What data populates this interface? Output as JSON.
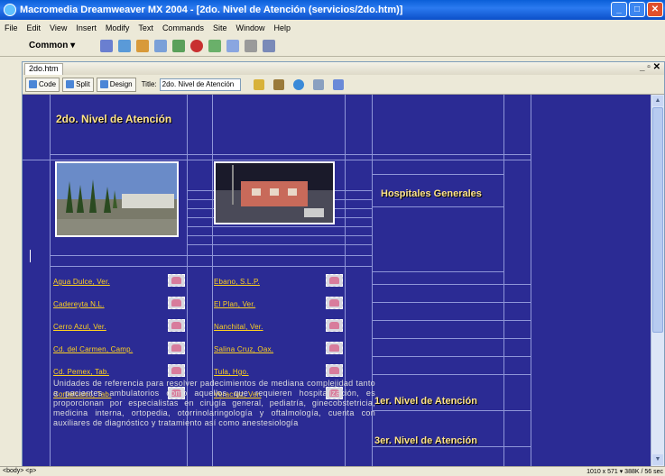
{
  "window": {
    "title": "Macromedia Dreamweaver MX 2004 - [2do. Nivel de Atención (servicios/2do.htm)]"
  },
  "menu": [
    "File",
    "Edit",
    "View",
    "Insert",
    "Modify",
    "Text",
    "Commands",
    "Site",
    "Window",
    "Help"
  ],
  "insert_bar": {
    "category": "Common ▾"
  },
  "document": {
    "tab": "2do.htm",
    "view_buttons": {
      "code": "Code",
      "split": "Split",
      "design": "Design"
    },
    "title_label": "Title:",
    "title_value": "2do. Nivel de Atención"
  },
  "page": {
    "heading": "2do. Nivel de Atención",
    "side_heading": "Hospitales Generales",
    "links_left": [
      "Agua Dulce, Ver.",
      "Cadereyta N.L.",
      "Cerro Azul, Ver.",
      "Cd. del Carmen, Camp.",
      "Cd. Pemex, Tab.",
      "Comalcalco, Tab."
    ],
    "links_right": [
      "Ebano, S.L.P.",
      "El Plan, Ver.",
      "Nanchital, Ver.",
      "Salina Cruz, Oax.",
      "Tula, Hgo.",
      "Veracruz, Ver."
    ],
    "nav1": "1er. Nivel de Atención",
    "nav3": "3er. Nivel de Atención",
    "body_text": "Unidades de referencia para resolver padecimientos de mediana complejidad tanto a pacientes ambulatorios como aquellos que requieren hospitalización, es proporcionan por especialistas en cirugía general, pediatría, ginecobstetricia, medicina interna, ortopedia, otorrinolaringología y oftalmología, cuenta con auxiliares de diagnóstico y tratamiento así como anestesiología"
  },
  "status": {
    "tags": "<body> <p>",
    "info": "1010 x 571 ▾ 388K / 56 sec"
  },
  "colors": {
    "canvas_bg": "#2b2b94",
    "link": "#ffd21f",
    "heading": "#ffe48a"
  }
}
